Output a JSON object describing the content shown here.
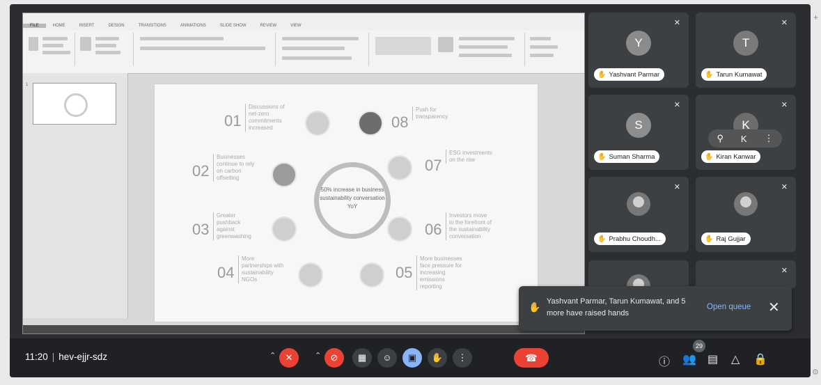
{
  "meeting": {
    "time": "11:20",
    "separator": "|",
    "code": "hev-ejjr-sdz",
    "participant_count": "29"
  },
  "slide": {
    "center_text": "50% increase in business sustainability conversation YoY",
    "items": [
      {
        "num": "01",
        "text": "Discussions of net-zero commitments increased"
      },
      {
        "num": "02",
        "text": "Businesses continue to rely on carbon offsetting"
      },
      {
        "num": "03",
        "text": "Greater pushback against greenwashing"
      },
      {
        "num": "04",
        "text": "More partnerships with sustainability NGOs"
      },
      {
        "num": "05",
        "text": "More businesses face pressure for increasing emissions reporting"
      },
      {
        "num": "06",
        "text": "Investors move to the forefront of the sustainability conversation"
      },
      {
        "num": "07",
        "text": "ESG investments on the rise"
      },
      {
        "num": "08",
        "text": "Push for transparency"
      }
    ]
  },
  "participants": [
    {
      "name": "Yashvant Parmar",
      "initial": "Y",
      "color": "#8b8b8b"
    },
    {
      "name": "Tarun Kumawat",
      "initial": "T",
      "color": "#7a7a7a"
    },
    {
      "name": "Suman Sharma",
      "initial": "S",
      "color": "#8d8d8d"
    },
    {
      "name": "Kiran Kanwar",
      "initial": "K",
      "color": "#6d6d6d"
    },
    {
      "name": "Prabhu Choudh...",
      "initial": "",
      "color": "#777777"
    },
    {
      "name": "Raj Gujjar",
      "initial": "",
      "color": "#777777"
    }
  ],
  "toast": {
    "message": "Yashvant Parmar, Tarun Kumawat, and 5 more have raised hands",
    "action": "Open queue",
    "close": "✕"
  },
  "icons": {
    "mic_off": "✕",
    "hand": "✋",
    "pin": "⚲",
    "more": "⋮",
    "info": "ⓘ",
    "people": "👥",
    "chat": "▤",
    "activities": "△",
    "lock": "🔒",
    "emoji": "☺",
    "present": "▣",
    "captions": "▦",
    "end": "☎"
  },
  "ppt": {
    "tabs": [
      "FILE",
      "HOME",
      "INSERT",
      "DESIGN",
      "TRANSITIONS",
      "ANIMATIONS",
      "SLIDE SHOW",
      "REVIEW",
      "VIEW"
    ]
  }
}
